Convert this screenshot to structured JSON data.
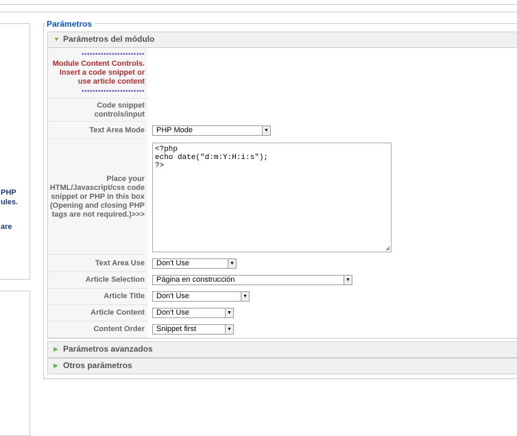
{
  "left_panel": {
    "lines": [
      "PHP",
      "ules.",
      "are"
    ]
  },
  "fieldset": {
    "legend": "Parámetros"
  },
  "sections": {
    "module_params": "Parámetros del módulo",
    "advanced_params": "Parámetros avanzados",
    "other_params": "Otros parámetros"
  },
  "rows": {
    "header": {
      "dots": "•••••••••••••••••••••••",
      "text": "Module Content Controls. Insert a code snippet or use article content"
    },
    "snippet_controls": {
      "label": "Code snippet controls/input"
    },
    "text_area_mode": {
      "label": "Text Area Mode",
      "value": "PHP Mode"
    },
    "code": {
      "label": "Place your HTML/Javascript/css code snippet or PHP in this box (Opening and closing PHP tags are not required.)>>>",
      "value": "<?php\necho date(\"d:m:Y:H:i:s\");\n?>"
    },
    "text_area_use": {
      "label": "Text Area Use",
      "value": "Don't Use"
    },
    "article_selection": {
      "label": "Article Selection",
      "value": "Página en construcción"
    },
    "article_title": {
      "label": "Article Title",
      "value": "Don't Use"
    },
    "article_content": {
      "label": "Article Content",
      "value": "Don't Use"
    },
    "content_order": {
      "label": "Content Order",
      "value": "Snippet first"
    }
  },
  "icons": {
    "expanded": "triangle-down-icon",
    "collapsed": "triangle-right-icon"
  },
  "colors": {
    "legend": "#0b55c4",
    "accent_arrow": "#6fb24b",
    "warning_text": "#b03030",
    "dots": "#6a6ad8"
  }
}
